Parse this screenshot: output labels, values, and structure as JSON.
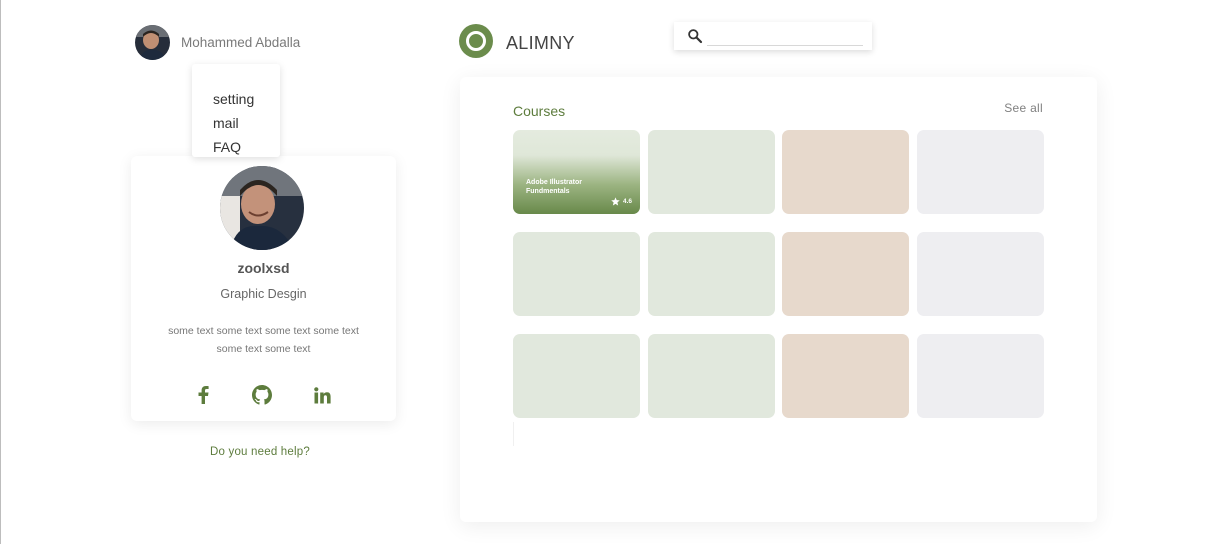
{
  "user": {
    "name": "Mohammed Abdalla"
  },
  "dropdown": {
    "items": [
      "setting",
      "mail",
      "FAQ"
    ]
  },
  "profile": {
    "username": "zoolxsd",
    "role": "Graphic Desgin",
    "bio": "some text some text some text some text some text some text",
    "socials": [
      {
        "icon": "facebook-icon"
      },
      {
        "icon": "github-icon"
      },
      {
        "icon": "linkedin-icon"
      }
    ]
  },
  "help": {
    "label": "Do you need help?"
  },
  "brand": {
    "name": "ALIMNY"
  },
  "search": {
    "placeholder": "",
    "icon": "search-icon"
  },
  "courses": {
    "title": "Courses",
    "see_all": "See all",
    "featured": {
      "title": "Adobe Illustrator Fundmentals",
      "rating": "4.6"
    },
    "tile_colors": [
      "#e1e8dd",
      "#e7d9cc",
      "#eeeef1"
    ]
  },
  "colors": {
    "accent": "#6b8c4c",
    "accent_text": "#5d7c3d"
  }
}
